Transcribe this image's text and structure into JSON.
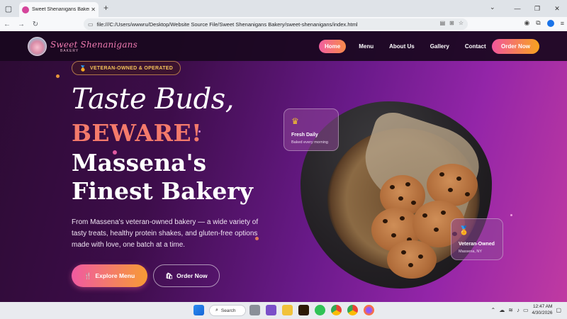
{
  "browser": {
    "tab_title": "Sweet Shenanigans Bakery | Ve",
    "tab_close": "✕",
    "new_tab": "+",
    "url": "file:///C:/Users/wwwru/Desktop/Website Source File/Sweet Shenanigans Bakery/sweet-shenanigans/index.html",
    "window_controls": [
      "⌄",
      "—",
      "❐",
      "✕"
    ]
  },
  "site": {
    "brand": "Sweet Shenanigans",
    "brand_sub": "BAKERY",
    "nav": [
      "Home",
      "Menu",
      "About Us",
      "Gallery",
      "Contact"
    ],
    "order_button": "Order Now"
  },
  "hero": {
    "badge": "VETERAN-OWNED & OPERATED",
    "line1": "Taste Buds,",
    "line2": "BEWARE!",
    "line3": "Massena's",
    "line4": "Finest Bakery",
    "description": "From Massena's veteran-owned bakery — a wide variety of tasty treats, healthy protein shakes, and gluten-free options made with love, one batch at a time.",
    "explore_button": "Explore Menu",
    "order_button": "Order Now",
    "card1_title": "Fresh Daily",
    "card1_sub": "Baked every morning",
    "card2_title": "Veteran-Owned",
    "card2_sub": "Massena, NY"
  },
  "taskbar": {
    "search_label": "Search",
    "time": "12:47 AM",
    "date": "4/30/2026"
  },
  "colors": {
    "accent_pink": "#f25fa0",
    "accent_orange": "#f79b34",
    "beware": "#f47a6b",
    "badge_gold": "#f6c45a"
  }
}
